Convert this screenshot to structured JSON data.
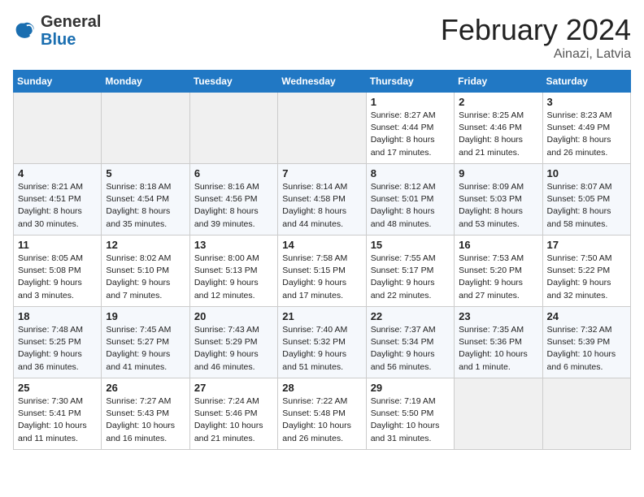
{
  "header": {
    "logo_general": "General",
    "logo_blue": "Blue",
    "month_title": "February 2024",
    "subtitle": "Ainazi, Latvia"
  },
  "columns": [
    "Sunday",
    "Monday",
    "Tuesday",
    "Wednesday",
    "Thursday",
    "Friday",
    "Saturday"
  ],
  "weeks": [
    [
      {
        "day": "",
        "info": ""
      },
      {
        "day": "",
        "info": ""
      },
      {
        "day": "",
        "info": ""
      },
      {
        "day": "",
        "info": ""
      },
      {
        "day": "1",
        "info": "Sunrise: 8:27 AM\nSunset: 4:44 PM\nDaylight: 8 hours\nand 17 minutes."
      },
      {
        "day": "2",
        "info": "Sunrise: 8:25 AM\nSunset: 4:46 PM\nDaylight: 8 hours\nand 21 minutes."
      },
      {
        "day": "3",
        "info": "Sunrise: 8:23 AM\nSunset: 4:49 PM\nDaylight: 8 hours\nand 26 minutes."
      }
    ],
    [
      {
        "day": "4",
        "info": "Sunrise: 8:21 AM\nSunset: 4:51 PM\nDaylight: 8 hours\nand 30 minutes."
      },
      {
        "day": "5",
        "info": "Sunrise: 8:18 AM\nSunset: 4:54 PM\nDaylight: 8 hours\nand 35 minutes."
      },
      {
        "day": "6",
        "info": "Sunrise: 8:16 AM\nSunset: 4:56 PM\nDaylight: 8 hours\nand 39 minutes."
      },
      {
        "day": "7",
        "info": "Sunrise: 8:14 AM\nSunset: 4:58 PM\nDaylight: 8 hours\nand 44 minutes."
      },
      {
        "day": "8",
        "info": "Sunrise: 8:12 AM\nSunset: 5:01 PM\nDaylight: 8 hours\nand 48 minutes."
      },
      {
        "day": "9",
        "info": "Sunrise: 8:09 AM\nSunset: 5:03 PM\nDaylight: 8 hours\nand 53 minutes."
      },
      {
        "day": "10",
        "info": "Sunrise: 8:07 AM\nSunset: 5:05 PM\nDaylight: 8 hours\nand 58 minutes."
      }
    ],
    [
      {
        "day": "11",
        "info": "Sunrise: 8:05 AM\nSunset: 5:08 PM\nDaylight: 9 hours\nand 3 minutes."
      },
      {
        "day": "12",
        "info": "Sunrise: 8:02 AM\nSunset: 5:10 PM\nDaylight: 9 hours\nand 7 minutes."
      },
      {
        "day": "13",
        "info": "Sunrise: 8:00 AM\nSunset: 5:13 PM\nDaylight: 9 hours\nand 12 minutes."
      },
      {
        "day": "14",
        "info": "Sunrise: 7:58 AM\nSunset: 5:15 PM\nDaylight: 9 hours\nand 17 minutes."
      },
      {
        "day": "15",
        "info": "Sunrise: 7:55 AM\nSunset: 5:17 PM\nDaylight: 9 hours\nand 22 minutes."
      },
      {
        "day": "16",
        "info": "Sunrise: 7:53 AM\nSunset: 5:20 PM\nDaylight: 9 hours\nand 27 minutes."
      },
      {
        "day": "17",
        "info": "Sunrise: 7:50 AM\nSunset: 5:22 PM\nDaylight: 9 hours\nand 32 minutes."
      }
    ],
    [
      {
        "day": "18",
        "info": "Sunrise: 7:48 AM\nSunset: 5:25 PM\nDaylight: 9 hours\nand 36 minutes."
      },
      {
        "day": "19",
        "info": "Sunrise: 7:45 AM\nSunset: 5:27 PM\nDaylight: 9 hours\nand 41 minutes."
      },
      {
        "day": "20",
        "info": "Sunrise: 7:43 AM\nSunset: 5:29 PM\nDaylight: 9 hours\nand 46 minutes."
      },
      {
        "day": "21",
        "info": "Sunrise: 7:40 AM\nSunset: 5:32 PM\nDaylight: 9 hours\nand 51 minutes."
      },
      {
        "day": "22",
        "info": "Sunrise: 7:37 AM\nSunset: 5:34 PM\nDaylight: 9 hours\nand 56 minutes."
      },
      {
        "day": "23",
        "info": "Sunrise: 7:35 AM\nSunset: 5:36 PM\nDaylight: 10 hours\nand 1 minute."
      },
      {
        "day": "24",
        "info": "Sunrise: 7:32 AM\nSunset: 5:39 PM\nDaylight: 10 hours\nand 6 minutes."
      }
    ],
    [
      {
        "day": "25",
        "info": "Sunrise: 7:30 AM\nSunset: 5:41 PM\nDaylight: 10 hours\nand 11 minutes."
      },
      {
        "day": "26",
        "info": "Sunrise: 7:27 AM\nSunset: 5:43 PM\nDaylight: 10 hours\nand 16 minutes."
      },
      {
        "day": "27",
        "info": "Sunrise: 7:24 AM\nSunset: 5:46 PM\nDaylight: 10 hours\nand 21 minutes."
      },
      {
        "day": "28",
        "info": "Sunrise: 7:22 AM\nSunset: 5:48 PM\nDaylight: 10 hours\nand 26 minutes."
      },
      {
        "day": "29",
        "info": "Sunrise: 7:19 AM\nSunset: 5:50 PM\nDaylight: 10 hours\nand 31 minutes."
      },
      {
        "day": "",
        "info": ""
      },
      {
        "day": "",
        "info": ""
      }
    ]
  ]
}
